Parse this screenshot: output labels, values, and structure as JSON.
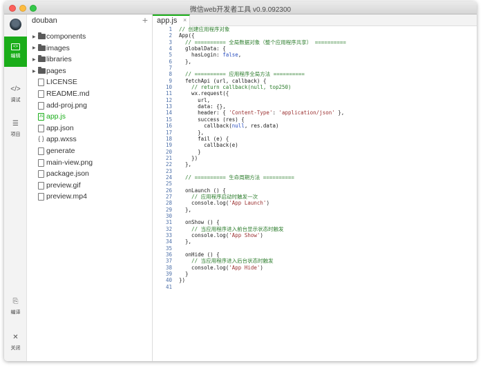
{
  "window": {
    "title": "微信web开发者工具 v0.9.092300"
  },
  "toolbar": {
    "items": [
      {
        "label": "编辑",
        "icon": "code-editor-icon",
        "glyph": "<>",
        "active": true
      },
      {
        "label": "调试",
        "icon": "debug-icon",
        "glyph": "</>",
        "active": false
      },
      {
        "label": "项目",
        "icon": "menu-list-icon",
        "glyph": "☰",
        "active": false
      }
    ],
    "bottom": [
      {
        "label": "编译",
        "icon": "compile-icon",
        "glyph": "⎘"
      },
      {
        "label": "关闭",
        "icon": "close-icon",
        "glyph": "✕"
      }
    ]
  },
  "project": {
    "name": "douban",
    "add_glyph": "+"
  },
  "files": [
    {
      "name": "components",
      "type": "folder",
      "caret": "▶"
    },
    {
      "name": "images",
      "type": "folder",
      "caret": "▶"
    },
    {
      "name": "libraries",
      "type": "folder",
      "caret": "▶"
    },
    {
      "name": "pages",
      "type": "folder",
      "caret": "▶"
    },
    {
      "name": "LICENSE",
      "type": "file"
    },
    {
      "name": "README.md",
      "type": "file"
    },
    {
      "name": "add-proj.png",
      "type": "image"
    },
    {
      "name": "app.js",
      "type": "js",
      "active": true,
      "badge": "JS"
    },
    {
      "name": "app.json",
      "type": "image"
    },
    {
      "name": "app.wxss",
      "type": "brace",
      "badge": "{ }"
    },
    {
      "name": "generate",
      "type": "file"
    },
    {
      "name": "main-view.png",
      "type": "image"
    },
    {
      "name": "package.json",
      "type": "image"
    },
    {
      "name": "preview.gif",
      "type": "image"
    },
    {
      "name": "preview.mp4",
      "type": "file"
    }
  ],
  "tab": {
    "label": "app.js",
    "close": "×"
  },
  "code": [
    "// 创建应用程序对象",
    "App({",
    "  // ========== 全局数据对象（整个应用程序共享） ==========",
    "  globalData: {",
    "    hasLogin: false,",
    "  },",
    "",
    "  // ========== 应用程序全局方法 ==========",
    "  fetchApi (url, callback) {",
    "    // return callback(null, top250)",
    "    wx.request({",
    "      url,",
    "      data: {},",
    "      header: { 'Content-Type': 'application/json' },",
    "      success (res) {",
    "        callback(null, res.data)",
    "      },",
    "      fail (e) {",
    "        callback(e)",
    "      }",
    "    })",
    "  },",
    "",
    "  // ========== 生命周期方法 ==========",
    "",
    "  onLaunch () {",
    "    // 应用程序启动时触发一次",
    "    console.log('App Launch')",
    "  },",
    "",
    "  onShow () {",
    "    // 当应用程序进入前台显示状态时触发",
    "    console.log('App Show')",
    "  },",
    "",
    "  onHide () {",
    "    // 当应用程序进入后台状态时触发",
    "    console.log('App Hide')",
    "  }",
    "})",
    ""
  ],
  "colors": {
    "accent": "#1aad19",
    "comment": "#2c7d2c",
    "string": "#9a2f2f",
    "keyword": "#2b4fbf",
    "line_number": "#4b6ea8"
  }
}
